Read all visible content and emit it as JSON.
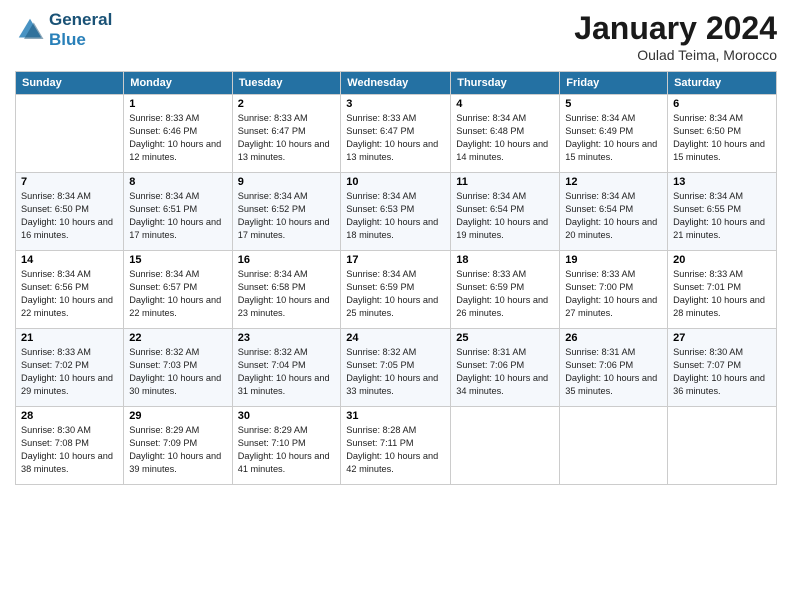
{
  "logo": {
    "line1": "General",
    "line2": "Blue"
  },
  "title": "January 2024",
  "subtitle": "Oulad Teima, Morocco",
  "days_of_week": [
    "Sunday",
    "Monday",
    "Tuesday",
    "Wednesday",
    "Thursday",
    "Friday",
    "Saturday"
  ],
  "weeks": [
    [
      {
        "day": "",
        "sunrise": "",
        "sunset": "",
        "daylight": ""
      },
      {
        "day": "1",
        "sunrise": "Sunrise: 8:33 AM",
        "sunset": "Sunset: 6:46 PM",
        "daylight": "Daylight: 10 hours and 12 minutes."
      },
      {
        "day": "2",
        "sunrise": "Sunrise: 8:33 AM",
        "sunset": "Sunset: 6:47 PM",
        "daylight": "Daylight: 10 hours and 13 minutes."
      },
      {
        "day": "3",
        "sunrise": "Sunrise: 8:33 AM",
        "sunset": "Sunset: 6:47 PM",
        "daylight": "Daylight: 10 hours and 13 minutes."
      },
      {
        "day": "4",
        "sunrise": "Sunrise: 8:34 AM",
        "sunset": "Sunset: 6:48 PM",
        "daylight": "Daylight: 10 hours and 14 minutes."
      },
      {
        "day": "5",
        "sunrise": "Sunrise: 8:34 AM",
        "sunset": "Sunset: 6:49 PM",
        "daylight": "Daylight: 10 hours and 15 minutes."
      },
      {
        "day": "6",
        "sunrise": "Sunrise: 8:34 AM",
        "sunset": "Sunset: 6:50 PM",
        "daylight": "Daylight: 10 hours and 15 minutes."
      }
    ],
    [
      {
        "day": "7",
        "sunrise": "Sunrise: 8:34 AM",
        "sunset": "Sunset: 6:50 PM",
        "daylight": "Daylight: 10 hours and 16 minutes."
      },
      {
        "day": "8",
        "sunrise": "Sunrise: 8:34 AM",
        "sunset": "Sunset: 6:51 PM",
        "daylight": "Daylight: 10 hours and 17 minutes."
      },
      {
        "day": "9",
        "sunrise": "Sunrise: 8:34 AM",
        "sunset": "Sunset: 6:52 PM",
        "daylight": "Daylight: 10 hours and 17 minutes."
      },
      {
        "day": "10",
        "sunrise": "Sunrise: 8:34 AM",
        "sunset": "Sunset: 6:53 PM",
        "daylight": "Daylight: 10 hours and 18 minutes."
      },
      {
        "day": "11",
        "sunrise": "Sunrise: 8:34 AM",
        "sunset": "Sunset: 6:54 PM",
        "daylight": "Daylight: 10 hours and 19 minutes."
      },
      {
        "day": "12",
        "sunrise": "Sunrise: 8:34 AM",
        "sunset": "Sunset: 6:54 PM",
        "daylight": "Daylight: 10 hours and 20 minutes."
      },
      {
        "day": "13",
        "sunrise": "Sunrise: 8:34 AM",
        "sunset": "Sunset: 6:55 PM",
        "daylight": "Daylight: 10 hours and 21 minutes."
      }
    ],
    [
      {
        "day": "14",
        "sunrise": "Sunrise: 8:34 AM",
        "sunset": "Sunset: 6:56 PM",
        "daylight": "Daylight: 10 hours and 22 minutes."
      },
      {
        "day": "15",
        "sunrise": "Sunrise: 8:34 AM",
        "sunset": "Sunset: 6:57 PM",
        "daylight": "Daylight: 10 hours and 22 minutes."
      },
      {
        "day": "16",
        "sunrise": "Sunrise: 8:34 AM",
        "sunset": "Sunset: 6:58 PM",
        "daylight": "Daylight: 10 hours and 23 minutes."
      },
      {
        "day": "17",
        "sunrise": "Sunrise: 8:34 AM",
        "sunset": "Sunset: 6:59 PM",
        "daylight": "Daylight: 10 hours and 25 minutes."
      },
      {
        "day": "18",
        "sunrise": "Sunrise: 8:33 AM",
        "sunset": "Sunset: 6:59 PM",
        "daylight": "Daylight: 10 hours and 26 minutes."
      },
      {
        "day": "19",
        "sunrise": "Sunrise: 8:33 AM",
        "sunset": "Sunset: 7:00 PM",
        "daylight": "Daylight: 10 hours and 27 minutes."
      },
      {
        "day": "20",
        "sunrise": "Sunrise: 8:33 AM",
        "sunset": "Sunset: 7:01 PM",
        "daylight": "Daylight: 10 hours and 28 minutes."
      }
    ],
    [
      {
        "day": "21",
        "sunrise": "Sunrise: 8:33 AM",
        "sunset": "Sunset: 7:02 PM",
        "daylight": "Daylight: 10 hours and 29 minutes."
      },
      {
        "day": "22",
        "sunrise": "Sunrise: 8:32 AM",
        "sunset": "Sunset: 7:03 PM",
        "daylight": "Daylight: 10 hours and 30 minutes."
      },
      {
        "day": "23",
        "sunrise": "Sunrise: 8:32 AM",
        "sunset": "Sunset: 7:04 PM",
        "daylight": "Daylight: 10 hours and 31 minutes."
      },
      {
        "day": "24",
        "sunrise": "Sunrise: 8:32 AM",
        "sunset": "Sunset: 7:05 PM",
        "daylight": "Daylight: 10 hours and 33 minutes."
      },
      {
        "day": "25",
        "sunrise": "Sunrise: 8:31 AM",
        "sunset": "Sunset: 7:06 PM",
        "daylight": "Daylight: 10 hours and 34 minutes."
      },
      {
        "day": "26",
        "sunrise": "Sunrise: 8:31 AM",
        "sunset": "Sunset: 7:06 PM",
        "daylight": "Daylight: 10 hours and 35 minutes."
      },
      {
        "day": "27",
        "sunrise": "Sunrise: 8:30 AM",
        "sunset": "Sunset: 7:07 PM",
        "daylight": "Daylight: 10 hours and 36 minutes."
      }
    ],
    [
      {
        "day": "28",
        "sunrise": "Sunrise: 8:30 AM",
        "sunset": "Sunset: 7:08 PM",
        "daylight": "Daylight: 10 hours and 38 minutes."
      },
      {
        "day": "29",
        "sunrise": "Sunrise: 8:29 AM",
        "sunset": "Sunset: 7:09 PM",
        "daylight": "Daylight: 10 hours and 39 minutes."
      },
      {
        "day": "30",
        "sunrise": "Sunrise: 8:29 AM",
        "sunset": "Sunset: 7:10 PM",
        "daylight": "Daylight: 10 hours and 41 minutes."
      },
      {
        "day": "31",
        "sunrise": "Sunrise: 8:28 AM",
        "sunset": "Sunset: 7:11 PM",
        "daylight": "Daylight: 10 hours and 42 minutes."
      },
      {
        "day": "",
        "sunrise": "",
        "sunset": "",
        "daylight": ""
      },
      {
        "day": "",
        "sunrise": "",
        "sunset": "",
        "daylight": ""
      },
      {
        "day": "",
        "sunrise": "",
        "sunset": "",
        "daylight": ""
      }
    ]
  ]
}
